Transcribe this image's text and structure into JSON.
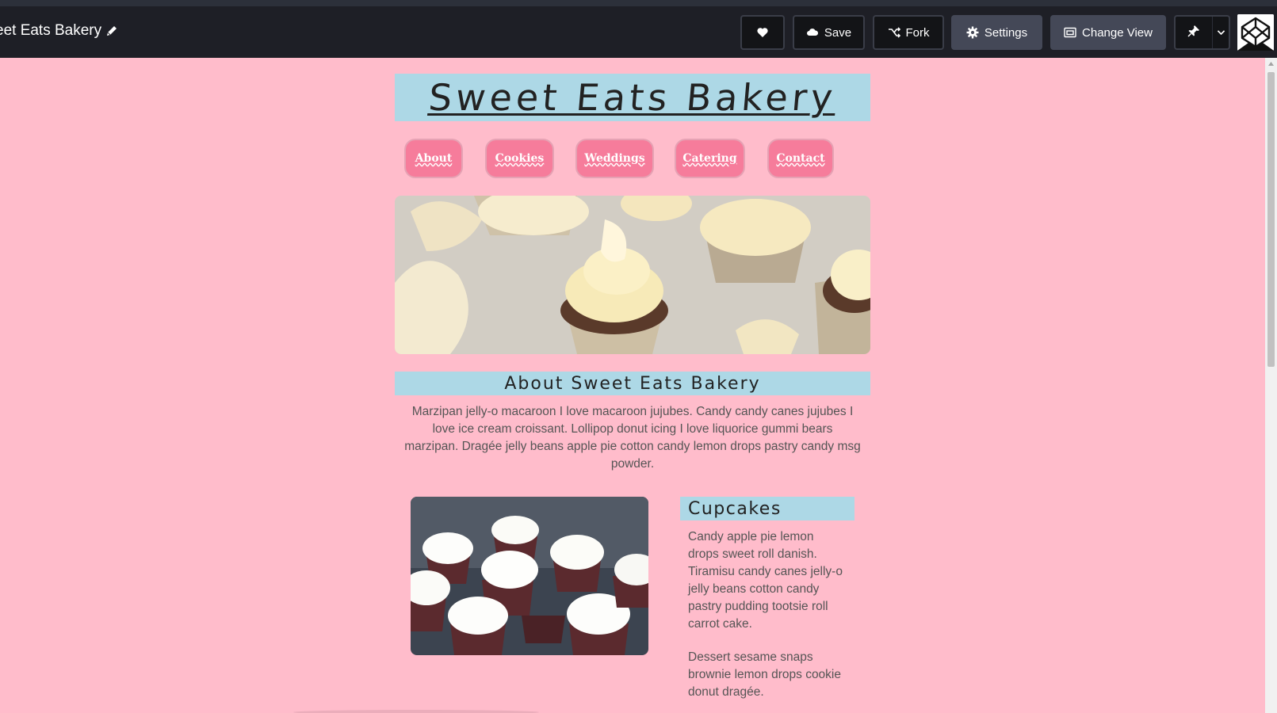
{
  "editor": {
    "pen_title": "eet Eats Bakery",
    "buttons": {
      "save": "Save",
      "fork": "Fork",
      "settings": "Settings",
      "change_view": "Change View"
    },
    "icons": {
      "edit": "pencil-icon",
      "like": "heart-icon",
      "save": "cloud-icon",
      "fork": "fork-icon",
      "settings": "gear-icon",
      "view": "view-icon",
      "pin": "pin-icon",
      "menu": "chevron-down-icon",
      "user": "codepen-logo"
    }
  },
  "site": {
    "title": "Sweet Eats Bakery",
    "nav": [
      "About",
      "Cookies",
      "Weddings",
      "Catering",
      "Contact"
    ],
    "about": {
      "heading": "About Sweet Eats Bakery",
      "text": "Marzipan jelly-o macaroon I love macaroon jujubes. Candy candy canes jujubes I love ice cream croissant. Lollipop donut icing I love liquorice gummi bears marzipan. Dragée jelly beans apple pie cotton candy lemon drops pastry candy msg powder."
    },
    "cupcakes": {
      "heading": "Cupcakes",
      "paragraphs": [
        "Candy apple pie lemon drops sweet roll danish. Tiramisu candy canes jelly-o jelly beans cotton candy pastry pudding tootsie roll carrot cake.",
        "Dessert sesame snaps brownie lemon drops cookie donut dragée."
      ]
    },
    "colors": {
      "background": "#ffbccb",
      "heading_band": "#add8e6",
      "nav_button": "#f67c9b"
    }
  }
}
